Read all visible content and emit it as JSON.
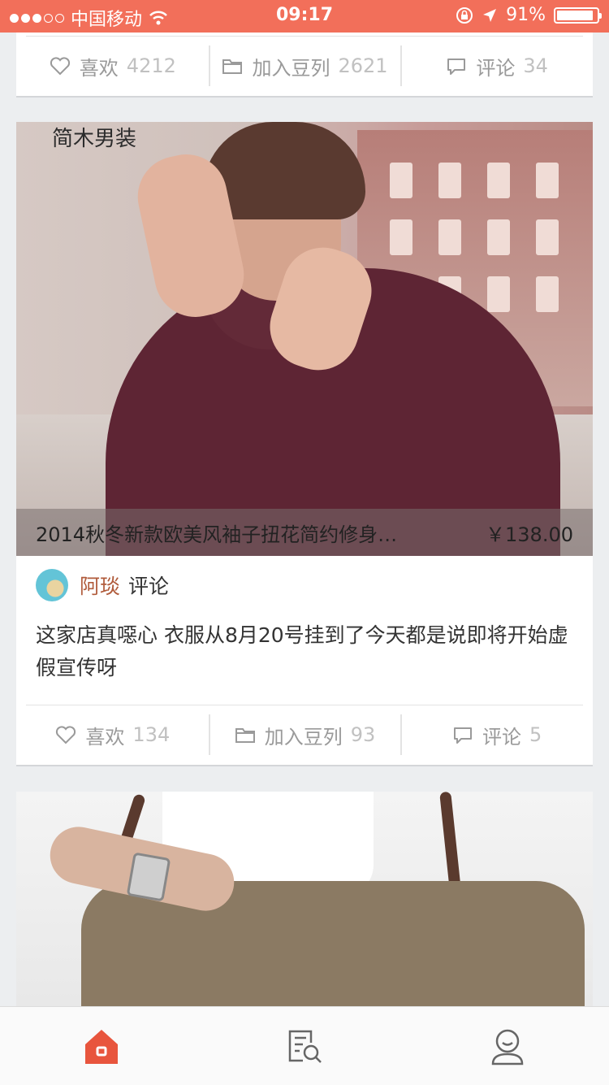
{
  "status_bar": {
    "carrier": "中国移动",
    "time": "09:17",
    "battery": "91%",
    "battery_level": 0.91
  },
  "feed": {
    "card_top": {
      "actions": [
        {
          "label": "喜欢",
          "count": "4212",
          "icon": "heart-icon"
        },
        {
          "label": "加入豆列",
          "count": "2621",
          "icon": "folder-icon"
        },
        {
          "label": "评论",
          "count": "34",
          "icon": "comment-icon"
        }
      ]
    },
    "card_main": {
      "photo_tag": "简木男装",
      "product_title": "2014秋冬新款欧美风袖子扭花简约修身…",
      "price": "￥138.00",
      "user_name": "阿琰",
      "comment_label": "评论",
      "comment_text": "这家店真噁心 衣服从8月20号挂到了今天都是说即将开始虚假宣传呀",
      "actions": [
        {
          "label": "喜欢",
          "count": "134",
          "icon": "heart-icon"
        },
        {
          "label": "加入豆列",
          "count": "93",
          "icon": "folder-icon"
        },
        {
          "label": "评论",
          "count": "5",
          "icon": "comment-icon"
        }
      ]
    }
  },
  "tabbar": {
    "items": [
      {
        "icon": "home-icon",
        "active": true
      },
      {
        "icon": "search-list-icon",
        "active": false
      },
      {
        "icon": "profile-icon",
        "active": false
      }
    ],
    "accent_color": "#e8553d"
  },
  "colors": {
    "status_bar": "#f26f5a",
    "username": "#b05b3b"
  }
}
